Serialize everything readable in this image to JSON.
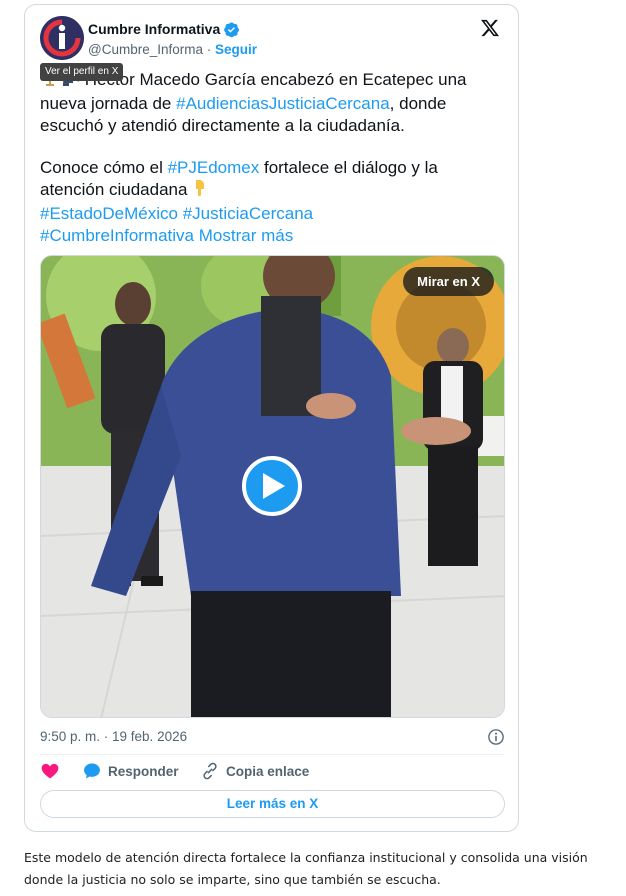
{
  "tweet": {
    "author_name": "Cumbre Informativa",
    "handle": "@Cumbre_Informa",
    "separator": " · ",
    "follow_label": "Seguir",
    "tooltip": "Ver el perfil en X",
    "text_line1_rest": " Héctor Macedo García encabezó en Ecatepec una nueva jornada de ",
    "hashtag_audiencias": "#AudienciasJusticiaCercana",
    "text_line1_end": ", donde escuchó y atendió directamente a la ciudadanía.",
    "text_p2_start": "Conoce cómo el ",
    "hashtag_pjedomex": "#PJEdomex",
    "text_p2_rest": " fortalece el diálogo y la atención ciudadana ",
    "hashtag_estado": "#EstadoDeMéxico",
    "hashtag_justicia": "#JusticiaCercana",
    "hashtag_cumbre": "#CumbreInformativa",
    "show_more": "Mostrar más",
    "watch_label": "Mirar en X",
    "timestamp": "9:50 p. m. · 19 feb. 2026",
    "reply_label": "Responder",
    "copy_link_label": "Copia enlace",
    "read_more_label": "Leer más en X"
  },
  "caption": "Este modelo de atención directa fortalece la confianza institucional y consolida una visión donde la justicia no solo se imparte, sino que también se escucha.",
  "icons": {
    "verified": "verified-badge-icon",
    "x_logo": "x-logo-icon",
    "play": "play-icon",
    "info": "info-icon",
    "heart": "heart-icon",
    "reply": "speech-bubble-icon",
    "link": "link-icon",
    "scales": "scales-emoji",
    "speaking": "speaking-head-emoji",
    "pointing": "pointing-down-emoji"
  },
  "colors": {
    "accent": "#1d9bf0",
    "text": "#0f1419",
    "muted": "#536471",
    "heart": "#f91880",
    "border": "#cfd9de"
  }
}
